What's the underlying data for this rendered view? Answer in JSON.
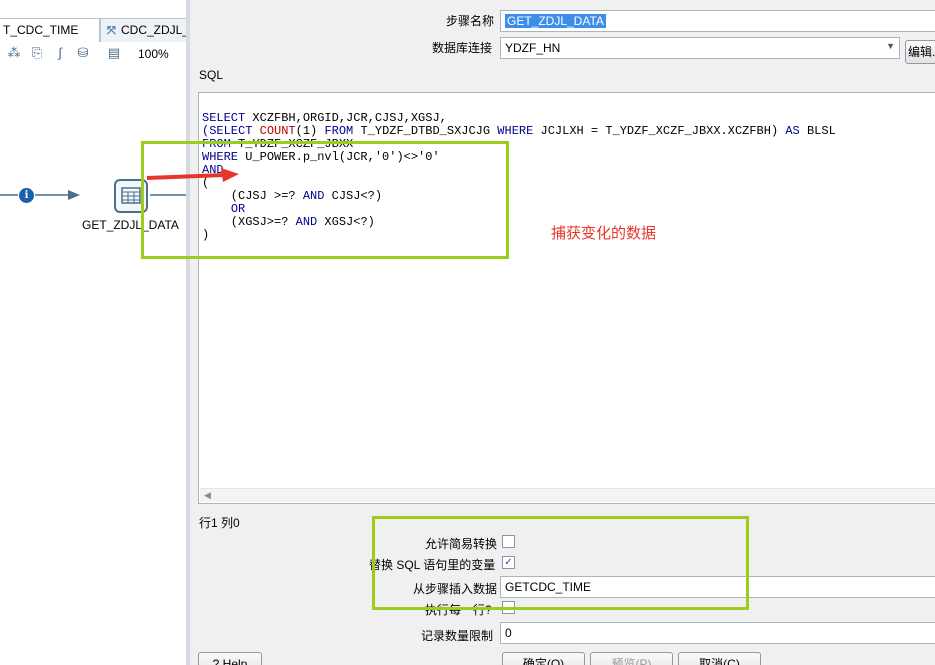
{
  "tabs": [
    {
      "label": "T_CDC_TIME"
    },
    {
      "label": "CDC_ZDJL_"
    }
  ],
  "toolbar": {
    "zoom": "100%"
  },
  "canvas": {
    "step_label": "GET_ZDJL_DATA",
    "info_glyph": "i"
  },
  "dialog": {
    "stepname_label": "步骤名称",
    "stepname_value": "GET_ZDJL_DATA",
    "db_label": "数据库连接",
    "db_value": "YDZF_HN",
    "edit_button": "编辑...",
    "sql_label": "SQL",
    "sql_lines": [
      "SELECT XCZFBH,ORGID,JCR,CJSJ,XGSJ,",
      "(SELECT COUNT(1) FROM T_YDZF_DTBD_SXJCJG WHERE JCJLXH = T_YDZF_XCZF_JBXX.XCZFBH) AS BLSL",
      "FROM T_YDZF_XCZF_JBXX",
      "WHERE U_POWER.p_nvl(JCR,'0')<>'0'",
      "AND",
      "(",
      "    (CJSJ >=? AND CJSJ<?)",
      "    OR",
      "    (XGSJ>=? AND XGSJ<?)",
      ")"
    ],
    "position": "行1 列0",
    "lazy_conversion_label": "允许简易转换",
    "lazy_conversion_checked": false,
    "replace_vars_label": "替换 SQL 语句里的变量",
    "replace_vars_checked": true,
    "insert_from_step_label": "从步骤插入数据",
    "insert_from_step_value": "GETCDC_TIME",
    "execute_each_row_label": "执行每一行?",
    "execute_each_row_checked": false,
    "limit_label": "记录数量限制",
    "limit_value": "0",
    "help_button": "Help",
    "ok_button": "确定(O)",
    "preview_button": "预览(P)",
    "cancel_button": "取消(C)"
  },
  "annotation": {
    "text": "捕获变化的数据",
    "color": "#e8352b",
    "box_color": "#9ccc1c"
  }
}
